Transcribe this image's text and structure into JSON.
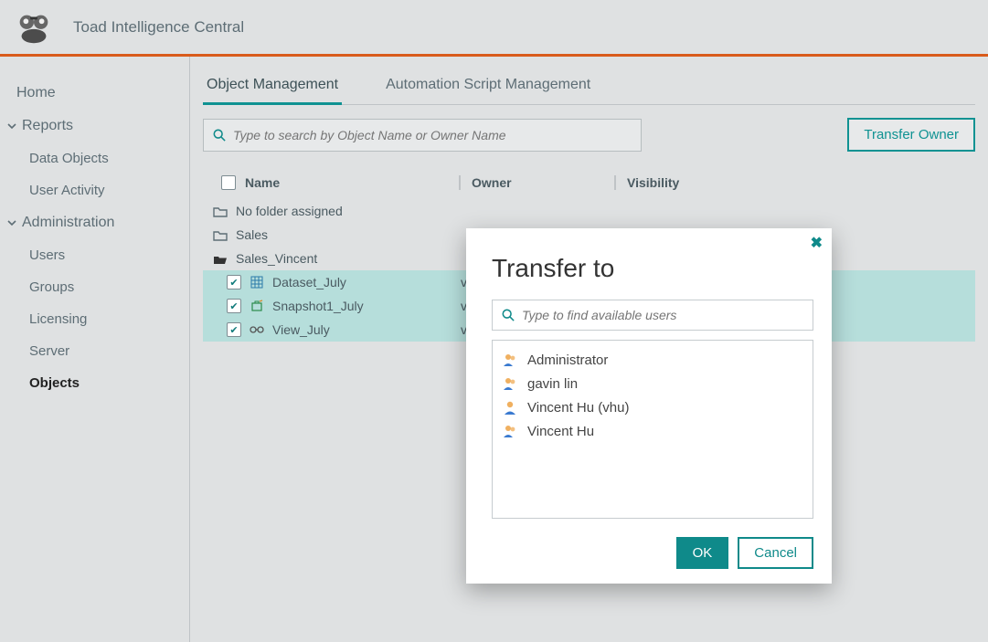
{
  "header": {
    "title": "Toad Intelligence Central"
  },
  "sidebar": {
    "home": "Home",
    "reports": {
      "label": "Reports",
      "items": [
        "Data Objects",
        "User Activity"
      ]
    },
    "admin": {
      "label": "Administration",
      "items": [
        "Users",
        "Groups",
        "Licensing",
        "Server",
        "Objects"
      ],
      "active": "Objects"
    }
  },
  "tabs": {
    "obj_mgmt": "Object Management",
    "auto_script": "Automation Script Management"
  },
  "search": {
    "placeholder": "Type to search by Object Name or Owner Name"
  },
  "transfer_btn": "Transfer Owner",
  "table": {
    "cols": {
      "name": "Name",
      "owner": "Owner",
      "visibility": "Visibility"
    },
    "folders": [
      {
        "name": "No folder assigned",
        "open": false
      },
      {
        "name": "Sales",
        "open": false
      },
      {
        "name": "Sales_Vincent",
        "open": true,
        "items": [
          {
            "name": "Dataset_July",
            "checked": true,
            "owner": "vi",
            "icon": "grid"
          },
          {
            "name": "Snapshot1_July",
            "checked": true,
            "owner": "vi",
            "icon": "snapshot"
          },
          {
            "name": "View_July",
            "checked": true,
            "owner": "vi",
            "icon": "view"
          }
        ]
      }
    ]
  },
  "dialog": {
    "title": "Transfer to",
    "search_placeholder": "Type to find available users",
    "users": [
      {
        "name": "Administrator",
        "type": "group"
      },
      {
        "name": "gavin lin",
        "type": "group"
      },
      {
        "name": "Vincent Hu (vhu)",
        "type": "single"
      },
      {
        "name": "Vincent Hu",
        "type": "group"
      }
    ],
    "ok": "OK",
    "cancel": "Cancel"
  }
}
